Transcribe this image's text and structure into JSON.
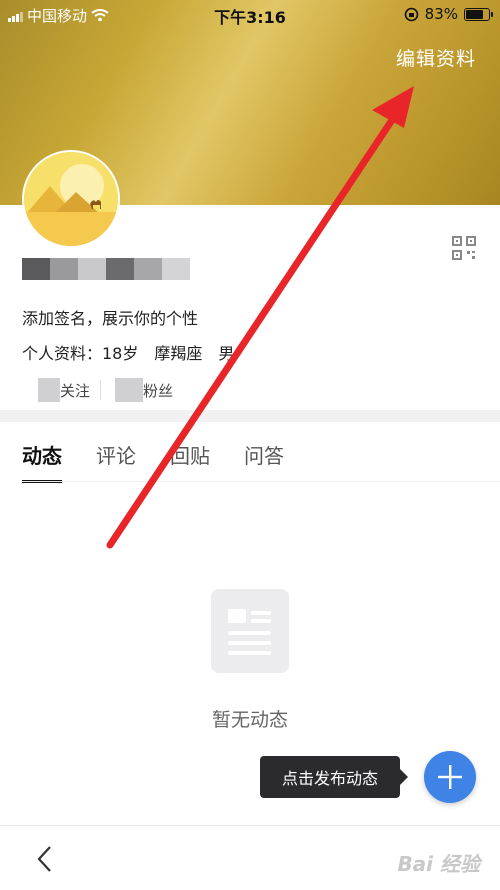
{
  "status_bar": {
    "carrier": "中国移动",
    "time": "下午3:16",
    "battery": "83%",
    "battery_level": 0.83
  },
  "header": {
    "edit_profile_label": "编辑资料"
  },
  "profile": {
    "signature": "添加签名，展示你的个性",
    "details": "个人资料：18岁　摩羯座　男",
    "follow_label": "关注",
    "fans_label": "粉丝"
  },
  "tabs": [
    {
      "label": "动态",
      "active": true
    },
    {
      "label": "评论",
      "active": false
    },
    {
      "label": "回贴",
      "active": false
    },
    {
      "label": "问答",
      "active": false
    }
  ],
  "empty_state": {
    "text": "暂无动态",
    "icon": "article-placeholder-icon"
  },
  "fab": {
    "tooltip": "点击发布动态",
    "icon": "plus-icon"
  },
  "bottom_bar": {
    "back_icon": "chevron-left-icon",
    "watermark": "Bai 经验"
  },
  "colors": {
    "banner": "#c7a735",
    "fab": "#3f83e6",
    "annotation_arrow": "#e8262a"
  }
}
